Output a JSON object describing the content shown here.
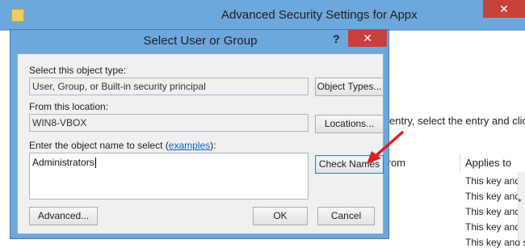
{
  "background_window": {
    "title": "Advanced Security Settings for Appx",
    "close_label": "✕",
    "instruction_fragment": "entry, select the entry and click E",
    "table": {
      "headers": [
        "from",
        "Applies to"
      ],
      "rows": [
        "This key and s",
        "This key and s",
        "This key and s",
        "This key and s",
        "This key and s"
      ]
    }
  },
  "dialog": {
    "title": "Select User or Group",
    "help_label": "?",
    "close_label": "✕",
    "object_type_label": "Select this object type:",
    "object_type_value": "User, Group, or Built-in security principal",
    "object_types_button": "Object Types...",
    "location_label": "From this location:",
    "location_value": "WIN8-VBOX",
    "locations_button": "Locations...",
    "name_label_prefix": "Enter the object name to select (",
    "name_label_link": "examples",
    "name_label_suffix": "):",
    "name_value": "Administrators",
    "check_names_button": "Check Names",
    "advanced_button": "Advanced...",
    "ok_button": "OK",
    "cancel_button": "Cancel"
  },
  "colors": {
    "titlebar": "#6da7db",
    "close": "#c7413a",
    "annotation_arrow": "#e0201c"
  }
}
